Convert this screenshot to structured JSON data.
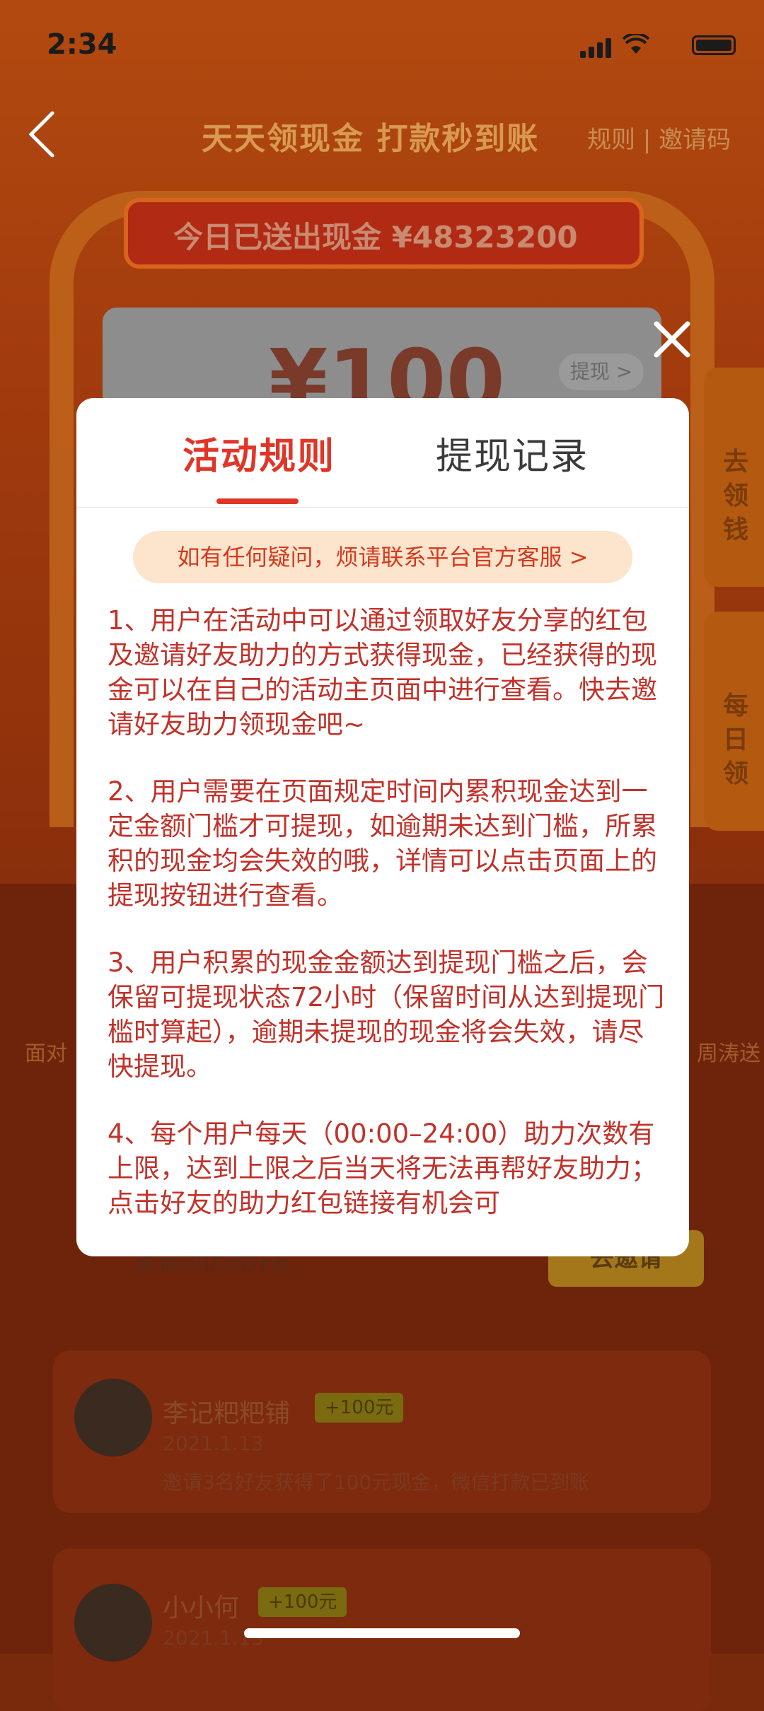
{
  "status_bar": {
    "time": "2:34"
  },
  "header": {
    "title": "天天领现金 打款秒到账",
    "links": "规则 | 邀请码"
  },
  "banner": {
    "text": "今日已送出现金 ¥48323200"
  },
  "background_card": {
    "amount": "¥100",
    "withdraw": "提现 >"
  },
  "side_tabs": [
    {
      "label": "去领钱"
    },
    {
      "label": "每日领"
    }
  ],
  "background_labels": {
    "left": "面对",
    "right": "周涛送"
  },
  "invite_row": {
    "text": "邀请超优质好友",
    "button": "去邀请"
  },
  "feed": [
    {
      "name": "李记粑粑铺",
      "badge": "+100元",
      "date": "2021.1.13",
      "message": "邀请3名好友获得了100元现金，微信打款已到账"
    },
    {
      "name": "小小何",
      "badge": "+100元",
      "date": "2021.1.13"
    }
  ],
  "modal": {
    "tabs": [
      {
        "label": "活动规则",
        "active": true
      },
      {
        "label": "提现记录",
        "active": false
      }
    ],
    "contact": "如有任何疑问，烦请联系平台官方客服 >",
    "rules": [
      "1、用户在活动中可以通过领取好友分享的红包及邀请好友助力的方式获得现金，已经获得的现金可以在自己的活动主页面中进行查看。快去邀请好友助力领现金吧~",
      "2、用户需要在页面规定时间内累积现金达到一定金额门槛才可提现，如逾期未达到门槛，所累积的现金均会失效的哦，详情可以点击页面上的提现按钮进行查看。",
      "3、用户积累的现金金额达到提现门槛之后，会保留可提现状态72小时（保留时间从达到提现门槛时算起），逾期未提现的现金将会失效，请尽快提现。",
      "4、每个用户每天（00:00–24:00）助力次数有上限，达到上限之后当天将无法再帮好友助力；点击好友的助力红包链接有机会可"
    ]
  },
  "colors": {
    "accent": "#e03628",
    "rule_text": "#c1322a",
    "pill_bg": "#fde4cc"
  }
}
